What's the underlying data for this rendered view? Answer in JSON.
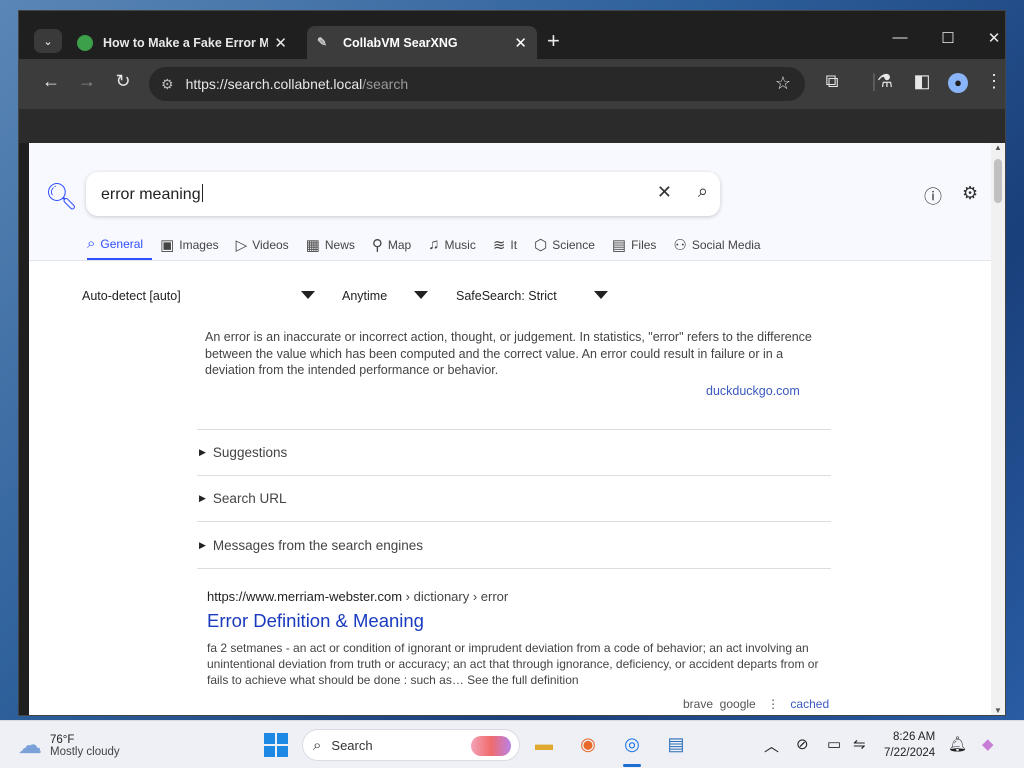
{
  "browser": {
    "tabs": [
      {
        "title": "How to Make a Fake Error Mes",
        "active": false
      },
      {
        "title": "CollabVM SearXNG",
        "active": true
      }
    ],
    "url_host": "https://search.collabnet.local",
    "url_path": "/search"
  },
  "search": {
    "query": "error meaning",
    "categories": [
      {
        "label": "General",
        "icon": "search-icon",
        "active": true
      },
      {
        "label": "Images",
        "icon": "image-icon"
      },
      {
        "label": "Videos",
        "icon": "play-icon"
      },
      {
        "label": "News",
        "icon": "newspaper-icon"
      },
      {
        "label": "Map",
        "icon": "map-pin-icon"
      },
      {
        "label": "Music",
        "icon": "music-icon"
      },
      {
        "label": "It",
        "icon": "layers-icon"
      },
      {
        "label": "Science",
        "icon": "science-icon"
      },
      {
        "label": "Files",
        "icon": "files-icon"
      },
      {
        "label": "Social Media",
        "icon": "people-icon"
      }
    ],
    "filters": {
      "language": "Auto-detect [auto]",
      "time": "Anytime",
      "safesearch": "SafeSearch: Strict"
    }
  },
  "answer": {
    "text": "An error is an inaccurate or incorrect action, thought, or judgement. In statistics, \"error\" refers to the difference between the value which has been computed and the correct value. An error could result in failure or in a deviation from the intended performance or behavior.",
    "source": "duckduckgo.com"
  },
  "details": [
    "Suggestions",
    "Search URL",
    "Messages from the search engines"
  ],
  "result": {
    "url": "https://www.merriam-webster.com",
    "path": " › dictionary › error",
    "title": "Error Definition & Meaning",
    "content": "fa 2 setmanes - an act or condition of ignorant or imprudent deviation from a code of behavior; an act involving an unintentional deviation from truth or accuracy; an act that through ignorance, deficiency, or accident departs from or fails to achieve what should be done : such as… See the full definition",
    "engines": "brave  google",
    "cached": "cached"
  },
  "taskbar": {
    "temperature": "76°F",
    "condition": "Mostly cloudy",
    "search_label": "Search",
    "time": "8:26 AM",
    "date": "7/22/2024"
  },
  "colors": {
    "accent": "#3050ff",
    "link": "#1a3bbf",
    "taskbar_active": "#1a6fd1"
  }
}
